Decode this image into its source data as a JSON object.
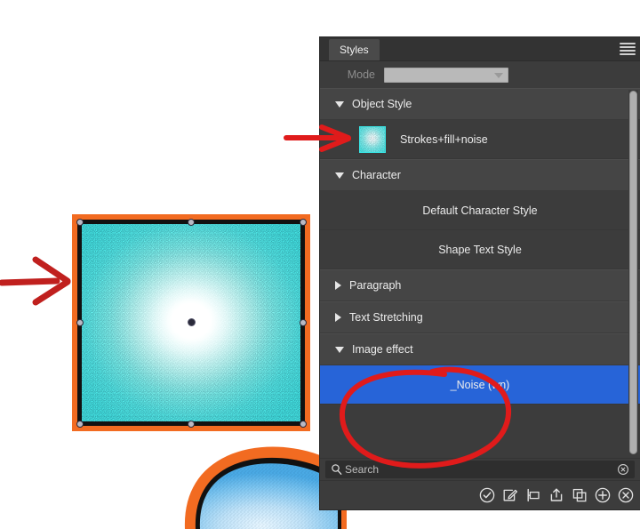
{
  "app": {
    "background_color": "#ffffff",
    "panel_background": "#3c3c3c",
    "accent_selected": "#2764d8",
    "annotation_color": "#e01b1b"
  },
  "panel": {
    "tab_label": "Styles",
    "menu_icon": "hamburger-menu-icon",
    "mode": {
      "label": "Mode",
      "value": "",
      "enabled": false,
      "caret_icon": "chevron-down-icon"
    },
    "sections": [
      {
        "id": "object-style",
        "label": "Object Style",
        "expanded": true,
        "triangle": "triangle-down-icon",
        "items": [
          {
            "label": "Strokes+fill+noise",
            "has_thumbnail": true,
            "thumbnail_name": "style-thumbnail-cyan-noise",
            "selected": false
          }
        ]
      },
      {
        "id": "character",
        "label": "Character",
        "expanded": true,
        "triangle": "triangle-down-icon",
        "items": [
          {
            "label": "Default Character Style",
            "has_thumbnail": false,
            "selected": false
          },
          {
            "label": "Shape Text Style",
            "has_thumbnail": false,
            "selected": false
          }
        ]
      },
      {
        "id": "paragraph",
        "label": "Paragraph",
        "expanded": false,
        "triangle": "triangle-right-icon",
        "items": []
      },
      {
        "id": "text-stretching",
        "label": "Text Stretching",
        "expanded": false,
        "triangle": "triangle-right-icon",
        "items": []
      },
      {
        "id": "image-effect",
        "label": "Image effect",
        "expanded": true,
        "triangle": "triangle-down-icon",
        "items": [
          {
            "label": "_Noise (wn)",
            "has_thumbnail": false,
            "selected": true
          }
        ]
      }
    ],
    "scrollbar": {
      "name": "vertical-scrollbar",
      "thumb_fraction": 0.99
    },
    "search": {
      "placeholder": "Search",
      "value": "",
      "icon": "search-icon",
      "clear_icon": "clear-circle-icon"
    },
    "toolbar": [
      {
        "name": "apply-style-button",
        "icon": "check-circle-icon"
      },
      {
        "name": "edit-style-button",
        "icon": "pencil-square-icon"
      },
      {
        "name": "rename-style-button",
        "icon": "rename-tag-icon"
      },
      {
        "name": "export-style-button",
        "icon": "upload-box-icon"
      },
      {
        "name": "duplicate-style-button",
        "icon": "duplicate-icon"
      },
      {
        "name": "add-style-button",
        "icon": "plus-circle-icon"
      },
      {
        "name": "delete-style-button",
        "icon": "close-circle-icon"
      }
    ]
  },
  "canvas": {
    "shapes": [
      {
        "name": "selected-rectangle-shape",
        "outer_stroke_color": "#f26b21",
        "inner_stroke_color": "#111111",
        "fill_description": "cyan radial gradient with white noise",
        "fill_center_color": "#ffffff",
        "fill_edge_color": "#45e6e6",
        "selected": true,
        "handle_count": 8,
        "has_center_point": true
      },
      {
        "name": "petal-shape",
        "outer_stroke_color": "#f26b21",
        "inner_stroke_color": "#111111",
        "fill_center_color": "#cfeaff",
        "fill_edge_color": "#5ab6ee",
        "selected": false
      }
    ]
  },
  "annotations": [
    {
      "name": "arrow-to-canvas-shape",
      "type": "arrow",
      "color": "#c0201e"
    },
    {
      "name": "arrow-to-object-style-item",
      "type": "arrow",
      "color": "#e01b1b"
    },
    {
      "name": "ellipse-around-noise-effect",
      "type": "ellipse",
      "color": "#e01b1b"
    }
  ]
}
